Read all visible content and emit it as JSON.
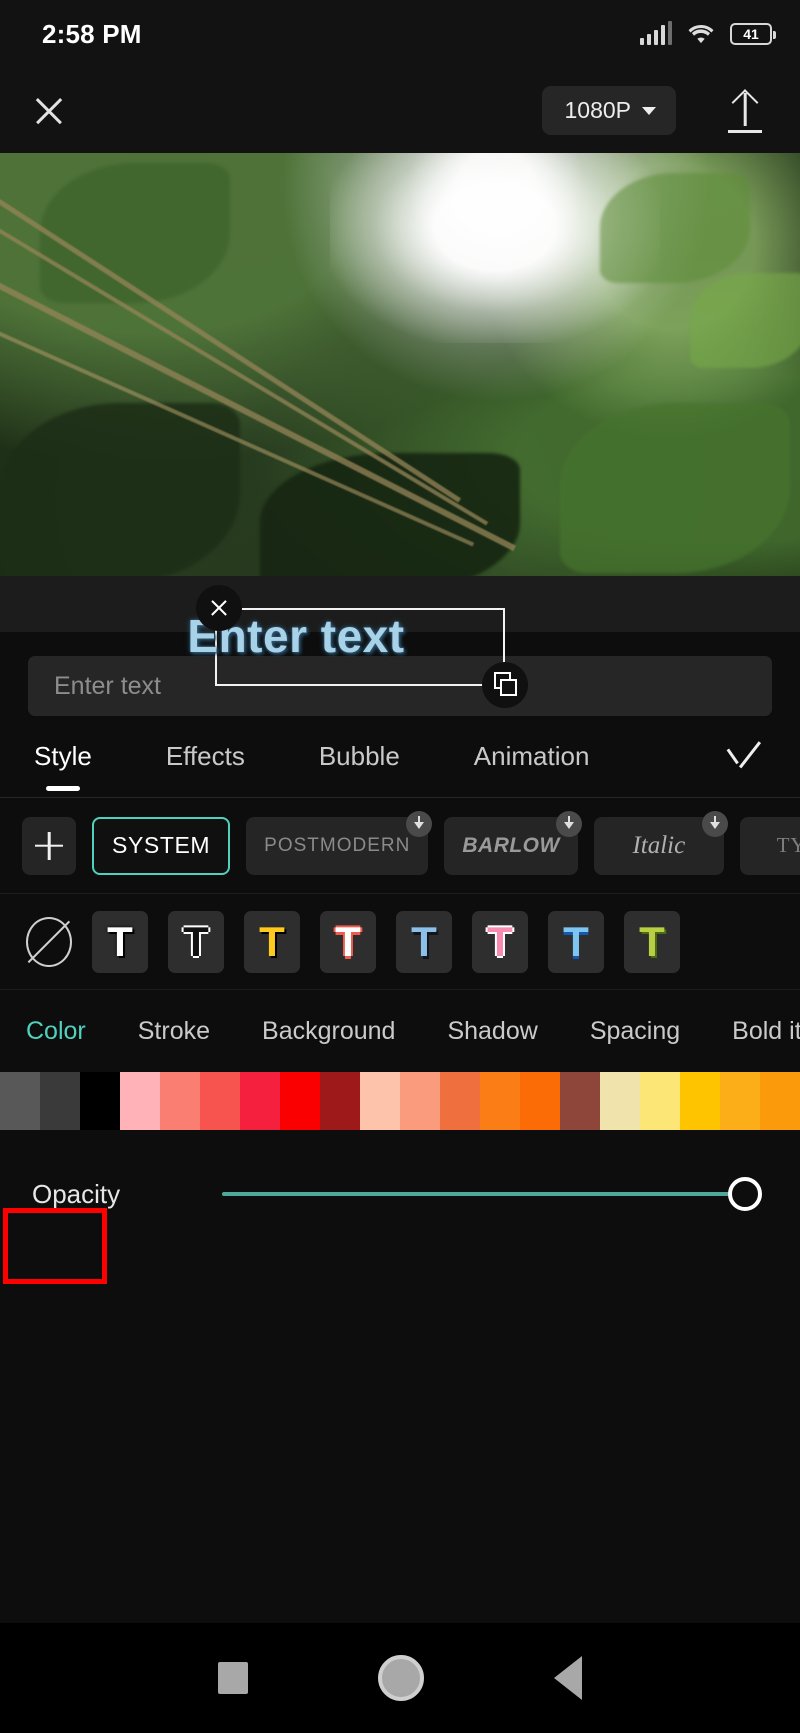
{
  "status_bar": {
    "time": "2:58 PM",
    "battery_percent": "41",
    "icons": [
      "signal-icon",
      "wifi-icon",
      "battery-icon"
    ]
  },
  "top_bar": {
    "close_label": "",
    "resolution": "1080P",
    "export_label": ""
  },
  "canvas": {
    "overlay_text": "Enter text",
    "overlay_text_color": "#a7d2e8",
    "delete_handle": "close-icon",
    "scale_handle": "resize-icon"
  },
  "text_input": {
    "value": "",
    "placeholder": "Enter text"
  },
  "tabs": {
    "items": [
      {
        "label": "Style",
        "active": true
      },
      {
        "label": "Effects",
        "active": false
      },
      {
        "label": "Bubble",
        "active": false
      },
      {
        "label": "Animation",
        "active": false
      }
    ],
    "confirm": "check-icon"
  },
  "fonts": {
    "add_label": "+",
    "items": [
      {
        "label": "SYSTEM",
        "selected": true,
        "download": false
      },
      {
        "label": "POSTMODERN",
        "selected": false,
        "download": true
      },
      {
        "label": "BARLOW",
        "selected": false,
        "download": true
      },
      {
        "label": "Italic",
        "selected": false,
        "download": true
      },
      {
        "label": "TYPE",
        "selected": false,
        "download": false
      }
    ]
  },
  "presets": {
    "none_label": "none-icon",
    "items": [
      {
        "glyph": "T",
        "fill": "#ffffff",
        "stroke": "#000000"
      },
      {
        "glyph": "T",
        "fill": "#111111",
        "stroke": "#ffffff"
      },
      {
        "glyph": "T",
        "fill": "#ffc91e",
        "stroke": "#000000"
      },
      {
        "glyph": "T",
        "fill": "#ffffff",
        "stroke": "#ef5b4c"
      },
      {
        "glyph": "T",
        "fill": "#8cc0e8",
        "stroke": "#12151c"
      },
      {
        "glyph": "T",
        "fill": "#f88bb0",
        "stroke": "#ffffff"
      },
      {
        "glyph": "T",
        "fill": "#7ec5f2",
        "stroke": "#1558b0"
      },
      {
        "glyph": "T",
        "fill": "#b9cf43",
        "stroke": "#4a6b12"
      }
    ]
  },
  "style_options": {
    "items": [
      {
        "label": "Color",
        "active": true
      },
      {
        "label": "Stroke",
        "active": false
      },
      {
        "label": "Background",
        "active": false
      },
      {
        "label": "Shadow",
        "active": false
      },
      {
        "label": "Spacing",
        "active": false
      },
      {
        "label": "Bold ital",
        "active": false
      }
    ],
    "highlight_color": "#ff0000",
    "active_color": "#4fd1bd"
  },
  "palette": {
    "swatches": [
      "#585858",
      "#3a3a3a",
      "#000000",
      "#ffb3b8",
      "#fa7f72",
      "#f75450",
      "#f51f3e",
      "#fb0000",
      "#9e1a1a",
      "#fdc3ab",
      "#fb9b7d",
      "#ef6f3f",
      "#fa7d16",
      "#fb6b06",
      "#8e463a",
      "#f0e3ac",
      "#fbe676",
      "#ffc400",
      "#fcae18",
      "#fb9a0a"
    ]
  },
  "opacity": {
    "label": "Opacity",
    "value": 100
  },
  "nav_bar": {
    "items": [
      "recents-square-icon",
      "home-circle-icon",
      "back-triangle-icon"
    ]
  }
}
